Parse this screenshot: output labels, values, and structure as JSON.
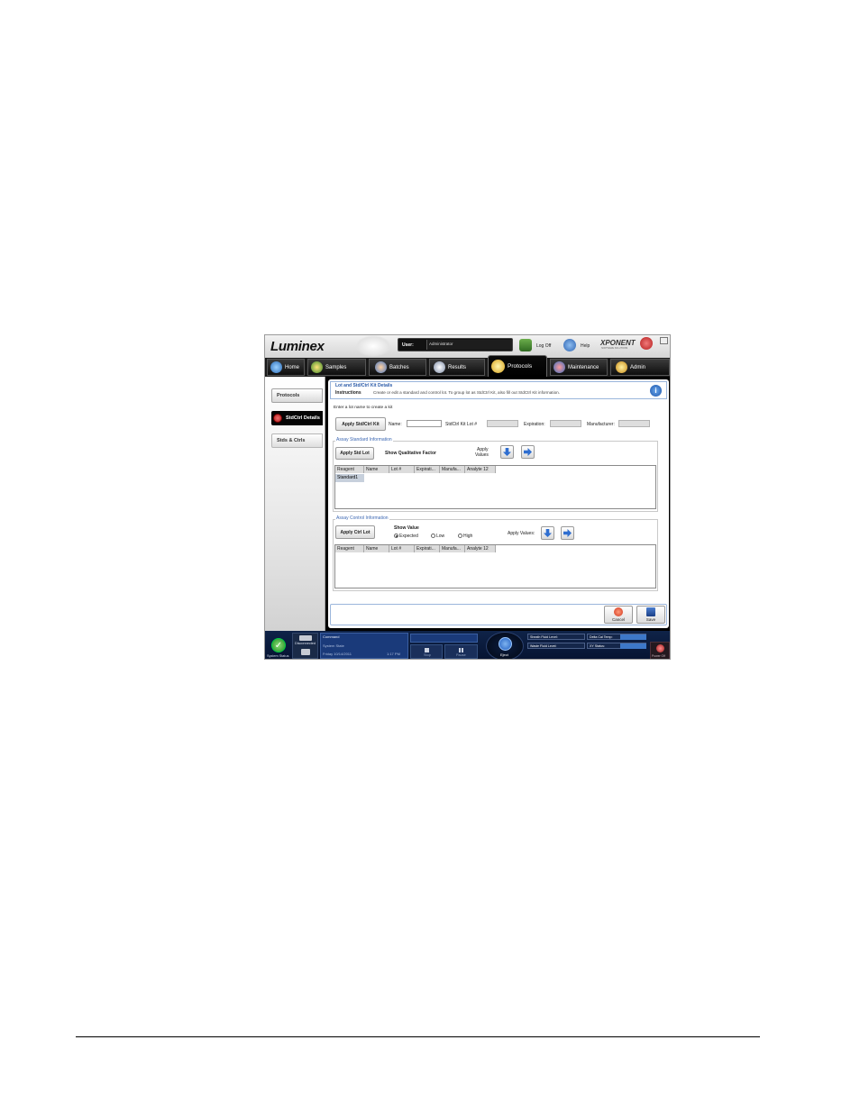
{
  "header": {
    "logo": "Luminex",
    "user_label": "User:",
    "user_value": "Administrator",
    "logoff_label": "Log Off",
    "help_label": "Help",
    "brand": "XPONENT",
    "brand_sub": "SOFTWARE SOLUTIONS"
  },
  "nav": {
    "tabs": [
      {
        "label": "Home"
      },
      {
        "label": "Samples"
      },
      {
        "label": "Batches"
      },
      {
        "label": "Results"
      },
      {
        "label": "Protocols"
      },
      {
        "label": "Maintenance"
      },
      {
        "label": "Admin"
      }
    ],
    "active": "Protocols"
  },
  "sidebar": {
    "items": [
      {
        "label": "Protocols"
      },
      {
        "label": "StdCtrl Details"
      },
      {
        "label": "Stds & Ctrls"
      }
    ]
  },
  "panel": {
    "title": "Lot and Std/Ctrl Kit Details",
    "instructions_label": "Instructions",
    "instructions_text": "Create or edit a standard and control lot. To group lot as StdCtrl Kit, also fill out StdCtrl Kit information.",
    "prompt": "Enter a lot name to create a kit",
    "apply_kit_button": "Apply Std/Ctrl Kit",
    "name_label": "Name:",
    "name_value": "",
    "kit_lot_label": "StdCtrl Kit Lot #",
    "expiration_label": "Expiration:",
    "manufacturer_label": "Manufacturer:"
  },
  "standard_section": {
    "legend": "Assay Standard Information",
    "apply_lot_button": "Apply Std Lot",
    "show_qualitative": "Show Qualitative Factor",
    "apply_values_line1": "Apply",
    "apply_values_line2": "Values",
    "columns": [
      "Reagent",
      "Name",
      "Lot #",
      "Expirati...",
      "Manufa...",
      "Analyte 12"
    ],
    "rows": [
      [
        "Standard1"
      ]
    ]
  },
  "control_section": {
    "legend": "Assay Control Information",
    "apply_lot_button": "Apply Ctrl Lot",
    "show_value_label": "Show Value",
    "options": [
      "Expected",
      "Low",
      "High"
    ],
    "selected": "Expected",
    "apply_values_label": "Apply Values:",
    "columns": [
      "Reagent",
      "Name",
      "Lot #",
      "Expirati...",
      "Manufa...",
      "Analyte 12"
    ]
  },
  "footer_buttons": {
    "cancel": "Cancel",
    "save": "Save"
  },
  "status_bar": {
    "system_status": "System Status",
    "connection": "Disconnected",
    "command_label": "Command",
    "system_state_label": "System State",
    "date": "Friday 10/14/2011",
    "time": "1:17 PM",
    "stop": "Stop",
    "pause": "Pause",
    "eject": "Eject",
    "sheath_level": "Sheath Fluid Level:",
    "waste_level": "Waste Fluid Level:",
    "delta_cal": "Delta Cal Temp:",
    "xy_status": "XY Status:",
    "power": "Power Off"
  },
  "colors": {
    "accent_blue": "#3d68b3",
    "nav_black": "#111111",
    "status_bar": "#0b1a3a",
    "active_red": "#cc1f1f"
  },
  "icons": [
    "info-icon",
    "down-arrow-icon",
    "right-arrow-icon",
    "cancel-icon",
    "save-icon",
    "check-icon",
    "eject-icon",
    "power-icon"
  ]
}
